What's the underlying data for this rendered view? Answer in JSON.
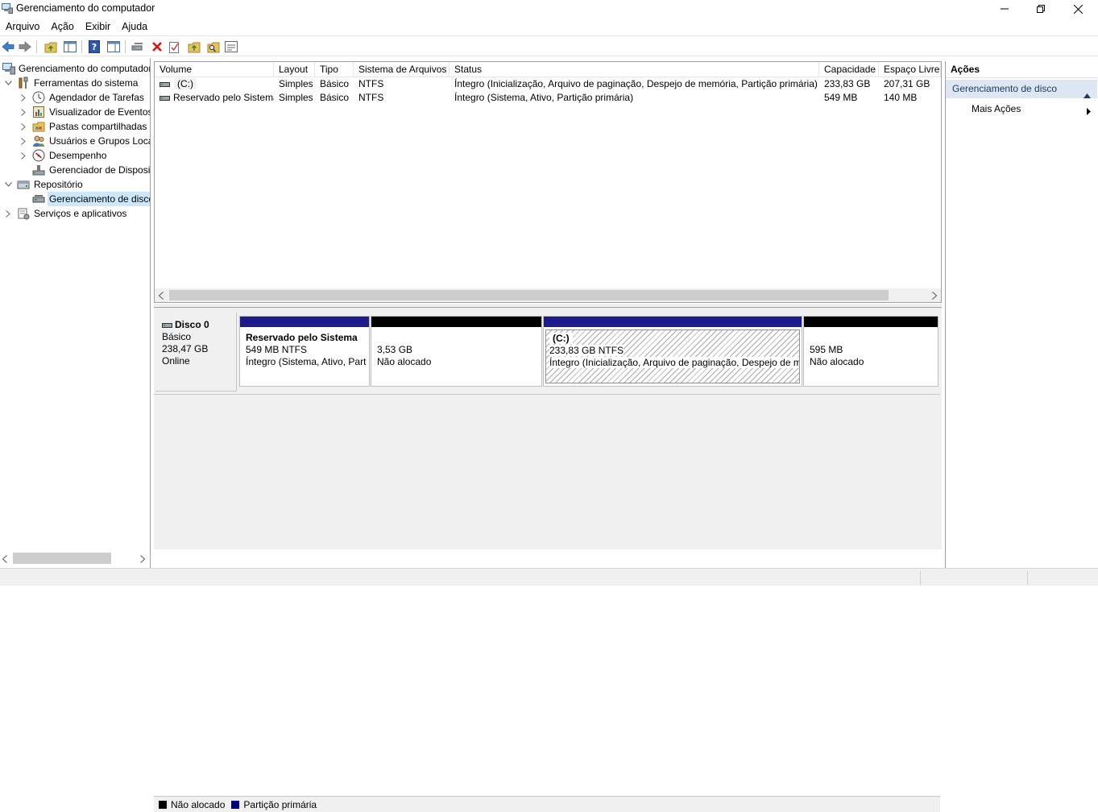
{
  "window": {
    "title": "Gerenciamento do computador",
    "controls": {
      "minimize": "minimize-icon",
      "restore": "restore-icon",
      "close": "close-icon"
    }
  },
  "menu": [
    "Arquivo",
    "Ação",
    "Exibir",
    "Ajuda"
  ],
  "toolbar": {
    "icons": [
      "back-arrow-icon",
      "forward-arrow-icon",
      "up-folder-icon",
      "show-hide-tree-icon",
      "help-icon",
      "properties-pane-icon",
      "connect-icon",
      "delete-icon",
      "checklist-icon",
      "import-icon",
      "search-icon",
      "console-icon"
    ]
  },
  "tree": {
    "root": "Gerenciamento do computador",
    "items": [
      {
        "label": "Ferramentas do sistema",
        "level": 1,
        "expanded": true,
        "icon": "tools-icon"
      },
      {
        "label": "Agendador de Tarefas",
        "level": 2,
        "expandable": true,
        "icon": "clock-icon"
      },
      {
        "label": "Visualizador de Eventos",
        "level": 2,
        "expandable": true,
        "icon": "event-viewer-icon"
      },
      {
        "label": "Pastas compartilhadas",
        "level": 2,
        "expandable": true,
        "icon": "shared-folder-icon"
      },
      {
        "label": "Usuários e Grupos Loca",
        "level": 2,
        "expandable": true,
        "icon": "users-icon"
      },
      {
        "label": "Desempenho",
        "level": 2,
        "expandable": true,
        "icon": "performance-icon"
      },
      {
        "label": "Gerenciador de Disposit",
        "level": 2,
        "expandable": false,
        "icon": "device-manager-icon"
      },
      {
        "label": "Repositório",
        "level": 1,
        "expanded": true,
        "icon": "storage-icon"
      },
      {
        "label": "Gerenciamento de disco",
        "level": 2,
        "expandable": false,
        "selected": true,
        "icon": "disk-icon"
      },
      {
        "label": "Serviços e aplicativos",
        "level": 1,
        "expandable": true,
        "icon": "services-icon"
      }
    ]
  },
  "volumes": {
    "columns": [
      "Volume",
      "Layout",
      "Tipo",
      "Sistema de Arquivos",
      "Status",
      "Capacidade",
      "Espaço Livre"
    ],
    "rows": [
      [
        "(C:)",
        "Simples",
        "Básico",
        "NTFS",
        "Íntegro (Inicialização, Arquivo de paginação, Despejo de memória, Partição primária)",
        "233,83 GB",
        "207,31 GB"
      ],
      [
        "Reservado pelo Sistema",
        "Simples",
        "Básico",
        "NTFS",
        "Íntegro (Sistema, Ativo, Partição primária)",
        "549 MB",
        "140 MB"
      ]
    ]
  },
  "disk": {
    "name": "Disco 0",
    "type": "Básico",
    "size": "238,47 GB",
    "state": "Online",
    "partitions": [
      {
        "title": "Reservado pelo Sistema",
        "size": "549 MB NTFS",
        "status": "Íntegro (Sistema, Ativo, Part",
        "kind": "primary"
      },
      {
        "title": "",
        "size": "3,53 GB",
        "status": "Não alocado",
        "kind": "unallocated"
      },
      {
        "title": "(C:)",
        "size": "233,83 GB NTFS",
        "status": "Íntegro (Inicialização, Arquivo de paginação, Despejo de m",
        "kind": "primary"
      },
      {
        "title": "",
        "size": "595 MB",
        "status": "Não alocado",
        "kind": "unallocated"
      }
    ]
  },
  "legend": [
    {
      "label": "Não alocado",
      "color": "#000000"
    },
    {
      "label": "Partição primária",
      "color": "#000080"
    }
  ],
  "actions": {
    "header": "Ações",
    "section": "Gerenciamento de disco",
    "items": [
      "Mais Ações"
    ]
  },
  "colors": {
    "primary": "#1c1c8c",
    "unallocated": "#000000",
    "selection": "#cce8ff",
    "actions_section": "#dde7f3"
  }
}
